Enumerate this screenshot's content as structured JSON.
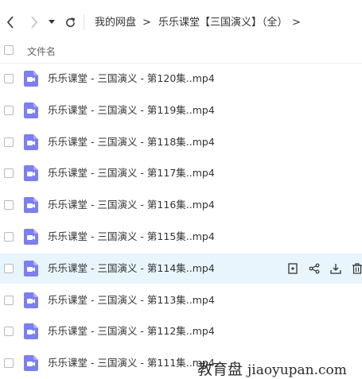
{
  "breadcrumb": {
    "root": "我的网盘",
    "folder": "乐乐课堂【三国演义】（全）",
    "sep": ">"
  },
  "header": {
    "file_name_label": "文件名"
  },
  "files": [
    {
      "name": "乐乐课堂 - 三国演义 - 第120集..mp4"
    },
    {
      "name": "乐乐课堂 - 三国演义 - 第119集..mp4"
    },
    {
      "name": "乐乐课堂 - 三国演义 - 第118集..mp4"
    },
    {
      "name": "乐乐课堂 - 三国演义 - 第117集..mp4"
    },
    {
      "name": "乐乐课堂 - 三国演义 - 第116集..mp4"
    },
    {
      "name": "乐乐课堂 - 三国演义 - 第115集..mp4"
    },
    {
      "name": "乐乐课堂 - 三国演义 - 第114集..mp4"
    },
    {
      "name": "乐乐课堂 - 三国演义 - 第113集..mp4"
    },
    {
      "name": "乐乐课堂 - 三国演义 - 第112集..mp4"
    },
    {
      "name": "乐乐课堂 - 三国演义 - 第111集..mp4"
    }
  ],
  "hovered_row_index": 6,
  "row_actions": [
    "info-icon",
    "share-icon",
    "download-icon",
    "delete-icon"
  ],
  "watermark": {
    "cn": "教育盘",
    "en": "jiaoyupan.com"
  },
  "colors": {
    "video_icon": "#7b7fef",
    "hover_bg": "#e9f5fd"
  }
}
